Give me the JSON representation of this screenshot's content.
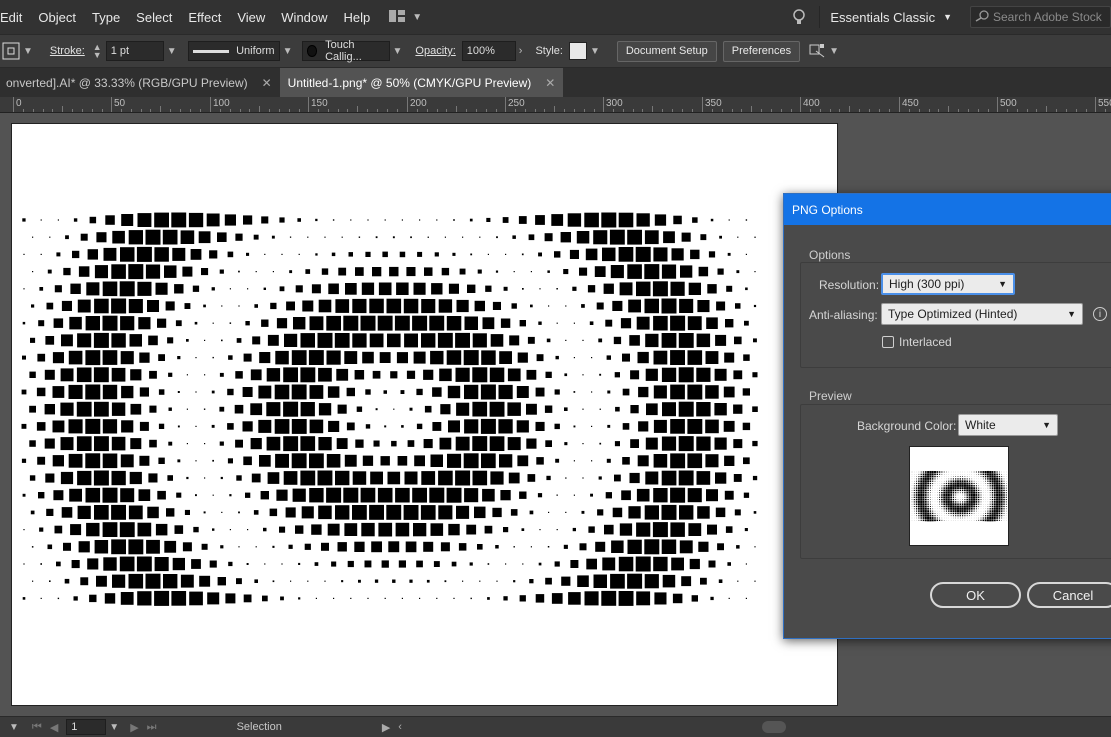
{
  "menu": [
    "Edit",
    "Object",
    "Type",
    "Select",
    "Effect",
    "View",
    "Window",
    "Help"
  ],
  "workspace": "Essentials Classic",
  "search_placeholder": "Search Adobe Stock",
  "controlbar": {
    "stroke_label": "Stroke:",
    "stroke_weight": "1 pt",
    "profile": "Uniform",
    "brush": "Touch Callig...",
    "opacity_label": "Opacity:",
    "opacity_value": "100%",
    "style_label": "Style:",
    "document_setup": "Document Setup",
    "preferences": "Preferences"
  },
  "tabs": [
    {
      "label": "onverted].AI* @ 33.33% (RGB/GPU Preview)",
      "active": false
    },
    {
      "label": "Untitled-1.png* @ 50% (CMYK/GPU Preview)",
      "active": true
    }
  ],
  "ruler_labels": [
    "0",
    "50",
    "100",
    "150",
    "200",
    "250",
    "300",
    "350",
    "400",
    "450",
    "500",
    "550"
  ],
  "status": {
    "page": "1",
    "tool": "Selection"
  },
  "dialog": {
    "title": "PNG Options",
    "options_title": "Options",
    "resolution_label": "Resolution:",
    "resolution_value": "High (300 ppi)",
    "antialias_label": "Anti-aliasing:",
    "antialias_value": "Type Optimized (Hinted)",
    "interlaced_label": "Interlaced",
    "interlaced_checked": false,
    "preview_title": "Preview",
    "bg_label": "Background Color:",
    "bg_value": "White",
    "ok": "OK",
    "cancel": "Cancel"
  },
  "colors": {
    "accent": "#1473e6",
    "app_bg": "#535353",
    "artboard": "#ffffff"
  }
}
